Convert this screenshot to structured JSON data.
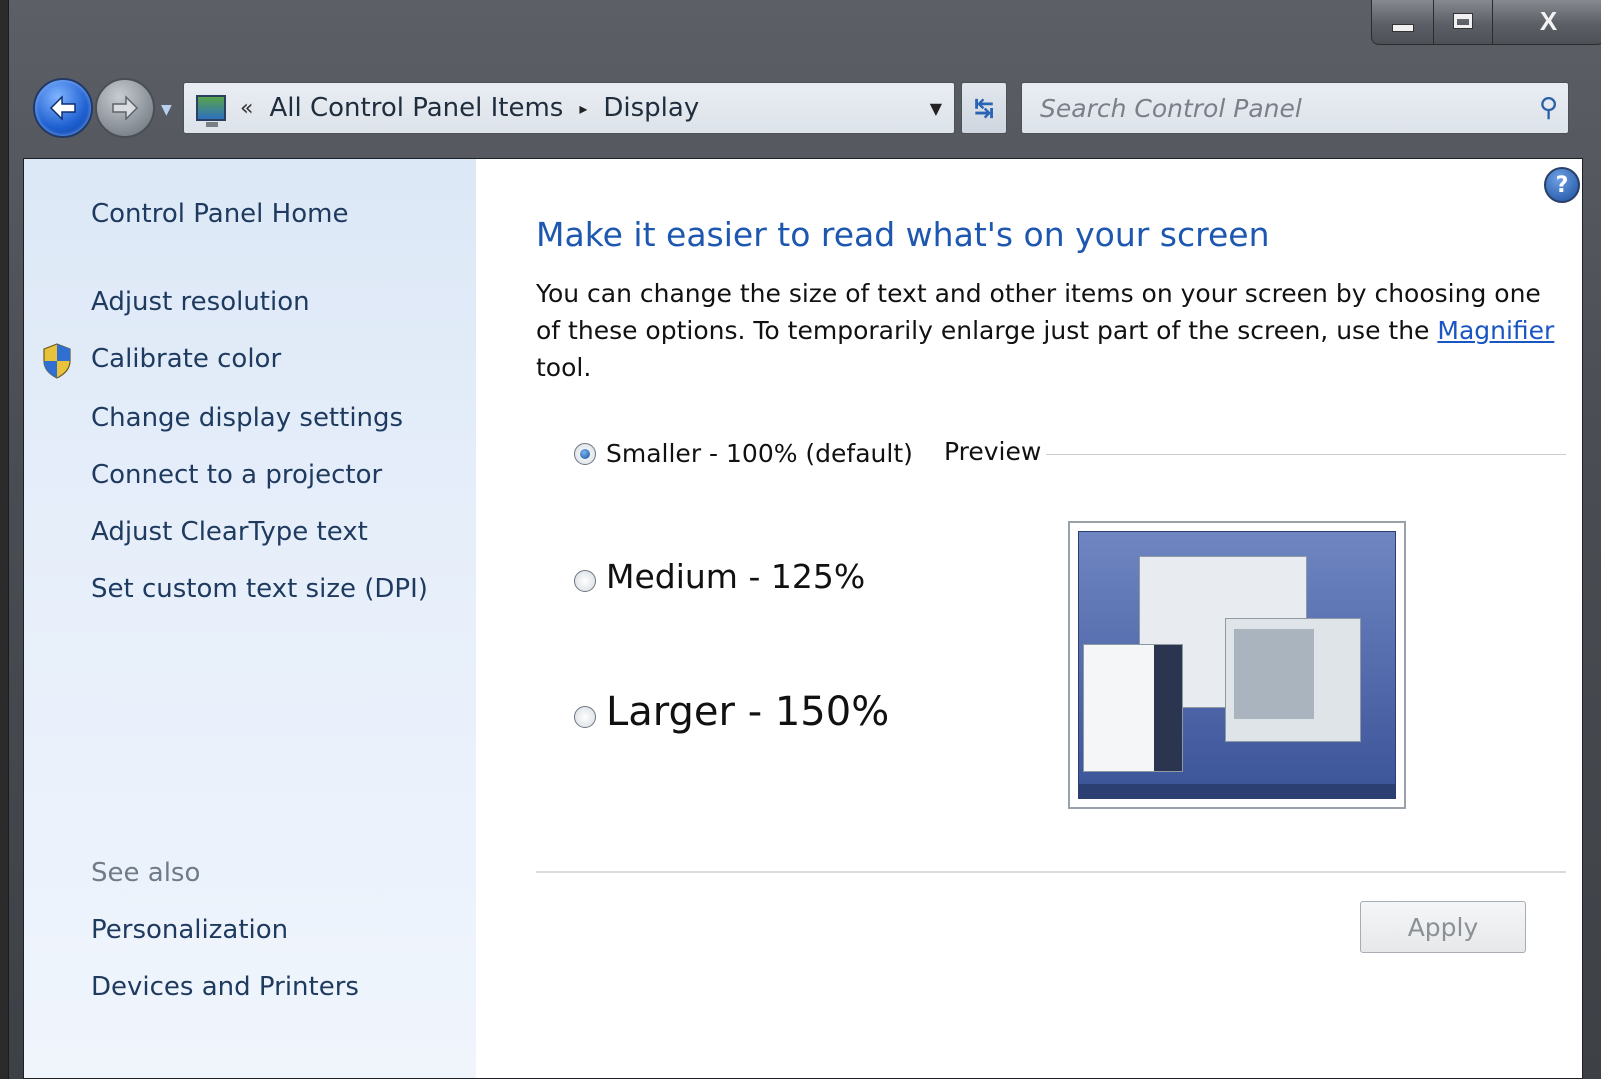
{
  "window": {
    "caption_buttons": {
      "minimize": "minimize-icon",
      "maximize": "maximize-icon",
      "close": "X"
    }
  },
  "nav": {
    "back_icon": "back-arrow-icon",
    "forward_icon": "forward-arrow-icon",
    "breadcrumb": {
      "chevron": "«",
      "items": [
        "All Control Panel Items",
        "Display"
      ],
      "separator": "▸"
    },
    "refresh_icon": "refresh-icon",
    "search": {
      "placeholder": "Search Control Panel",
      "icon": "search-icon"
    }
  },
  "sidebar": {
    "home": "Control Panel Home",
    "links": [
      "Adjust resolution",
      "Calibrate color",
      "Change display settings",
      "Connect to a projector",
      "Adjust ClearType text",
      "Set custom text size (DPI)"
    ],
    "see_also_label": "See also",
    "see_also": [
      "Personalization",
      "Devices and Printers"
    ]
  },
  "main": {
    "heading": "Make it easier to read what's on your screen",
    "description_before": "You can change the size of text and other items on your screen by choosing one of these options. To temporarily enlarge just part of the screen, use the ",
    "description_link": "Magnifier",
    "description_after": " tool.",
    "options": [
      {
        "label": "Smaller - 100% (default)",
        "selected": true
      },
      {
        "label": "Medium - 125%",
        "selected": false
      },
      {
        "label": "Larger - 150%",
        "selected": false
      }
    ],
    "preview_label": "Preview",
    "apply_label": "Apply",
    "apply_enabled": false
  },
  "colors": {
    "heading": "#1d57b0",
    "link": "#1a55c4",
    "sidebar_bg": "#dce8f6"
  }
}
